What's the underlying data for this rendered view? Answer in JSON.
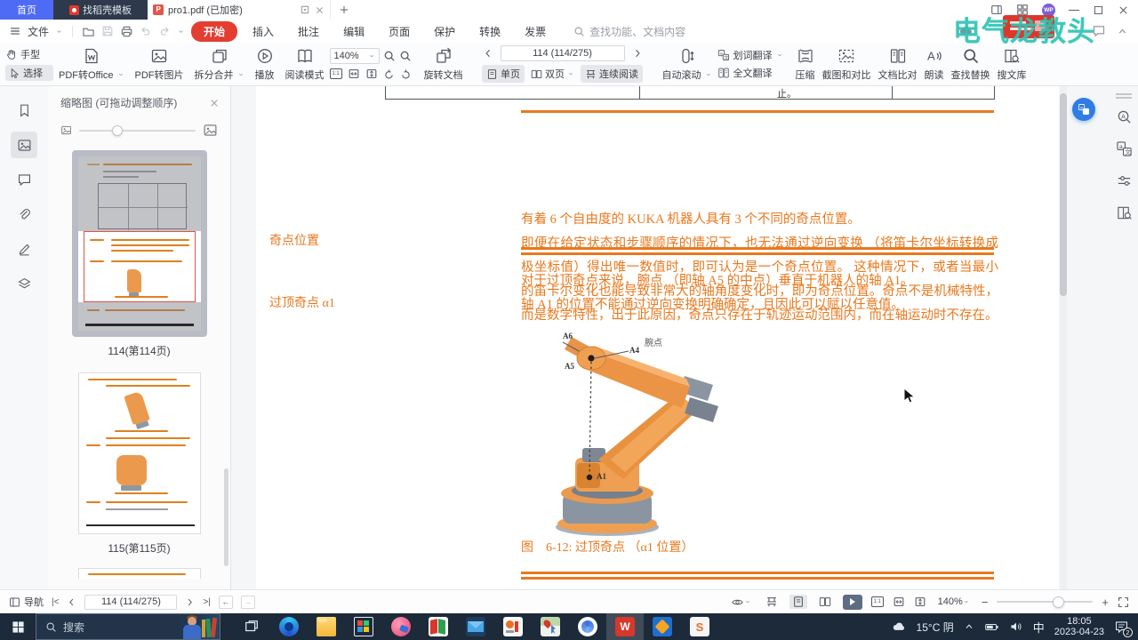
{
  "colors": {
    "accent_orange": "#e8791e",
    "wps_red": "#e43e31",
    "tab_blue": "#4e6bf5",
    "watermark_teal": "#2fc4b4",
    "taskbar_bg": "#1c2a3a",
    "float_blue": "#2e7ce4"
  },
  "watermark": {
    "text": "电气龙教头"
  },
  "tabbar": {
    "home_tab": "首页",
    "docer_tab": "找稻壳模板",
    "doc_tab": "pro1.pdf (已加密)"
  },
  "menubar": {
    "file": "文件",
    "items": [
      "开始",
      "插入",
      "批注",
      "编辑",
      "页面",
      "保护",
      "转换",
      "发票"
    ],
    "search_placeholder": "查找功能、文档内容"
  },
  "ribbon": {
    "hand": "手型",
    "select": "选择",
    "pdf_to_office": "PDF转Office",
    "pdf_to_image": "PDF转图片",
    "split_merge": "拆分合并",
    "play": "播放",
    "read_mode": "阅读模式",
    "zoom_value": "140%",
    "rotate_doc": "旋转文档",
    "page_nav": "114 (114/275)",
    "single_page": "单页",
    "double_page": "双页",
    "continuous": "连续阅读",
    "auto_scroll": "自动滚动",
    "word_translate": "划词翻译",
    "full_translate": "全文翻译",
    "compress": "压缩",
    "screenshot_compare": "截图和对比",
    "doc_compare": "文档比对",
    "read_aloud": "朗读",
    "find_replace": "查找替换",
    "search_library": "搜文库"
  },
  "sidebar": {
    "panel_title": "缩略图 (可拖动调整顺序)",
    "thumbnails": [
      {
        "label": "114(第114页)"
      },
      {
        "label": "115(第115页)"
      }
    ]
  },
  "document": {
    "table_fragment": "止。",
    "section1": {
      "label": "奇点位置",
      "para1": "有着 6 个自由度的 KUKA 机器人具有 3 个不同的奇点位置。",
      "para2": "即便在给定状态和步骤顺序的情况下，也无法通过逆向变换 （将笛卡尔坐标转换成极坐标值）得出唯一数值时，即可认为是一个奇点位置。 这种情况下，或者当最小的笛卡尔变化也能导致非常大的轴角度变化时，即为奇点位置。奇点不是机械特性，而是数学特性，出于此原因，奇点只存在于轨迹运动范围内，而在轴运动时不存在。"
    },
    "section2": {
      "label": "过顶奇点 α1",
      "para1": "对于过顶奇点来说，腕点 （即轴 A5 的中点）垂直于机器人的轴 A1。",
      "para2": "轴 A1 的位置不能通过逆向变换明确确定，且因此可以赋以任意值。"
    },
    "figure": {
      "label_a6": "A6",
      "label_a5": "A5",
      "label_a4": "A4",
      "label_wrist": "腕点",
      "label_a1": "A1",
      "caption": "图　6-12: 过顶奇点 （α1 位置）"
    }
  },
  "appstatus": {
    "nav": "导航",
    "page_nav": "114 (114/275)",
    "zoom_value": "140%"
  },
  "taskbar": {
    "search_placeholder": "搜索",
    "weather": "15°C 阴",
    "ime": "中",
    "time": "18:05",
    "date": "2023-04-23",
    "notification_count": "2",
    "app_icons": [
      "task-view",
      "edge-browser",
      "file-explorer",
      "microsoft-store",
      "pink-app",
      "security-app",
      "mail",
      "notes-app",
      "map-app",
      "downloader-app",
      "wps-office",
      "remote-app",
      "s-app"
    ]
  },
  "icons": {
    "strip": [
      "bookmark-icon",
      "thumbnails-icon",
      "comment-icon",
      "attachment-icon",
      "signature-icon",
      "layers-icon"
    ],
    "rail": [
      "find-icon",
      "translate-icon",
      "settings-sliders-icon",
      "search-library-icon"
    ]
  }
}
